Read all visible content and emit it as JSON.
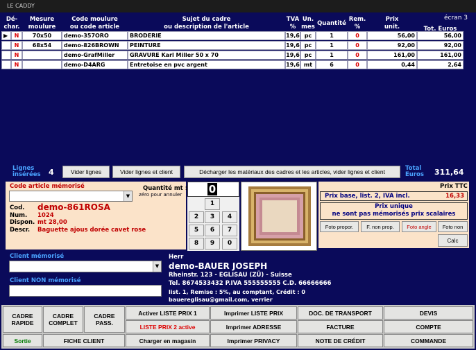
{
  "window": {
    "title": "LE CADDY",
    "screen_label": "écran 3"
  },
  "columns": {
    "dechar": "Dé-\nchar.",
    "mesure": "Mesure\nmoulure",
    "code": "Code moulure\nou code article",
    "sujet": "Sujet du cadre\nou description de l'article",
    "tva": "TVA\n%",
    "unmes": "Un.\nmes",
    "quantite": "Quantité",
    "rem": "Rem.\n%",
    "prix": "Prix\nunit.",
    "total": "Tot. Euros"
  },
  "rows": [
    {
      "pointer": "▶",
      "flag": "N",
      "mesure": "70x50",
      "code": "demo-357ORO",
      "desc": "BRODERIE",
      "tva": "19,6",
      "unit": "pc",
      "qty": "1",
      "rem": "0",
      "prix": "56,00",
      "total": "56,00"
    },
    {
      "pointer": "",
      "flag": "N",
      "mesure": "68x54",
      "code": "demo-826BROWN",
      "desc": "PEINTURE",
      "tva": "19,6",
      "unit": "pc",
      "qty": "1",
      "rem": "0",
      "prix": "92,00",
      "total": "92,00"
    },
    {
      "pointer": "",
      "flag": "N",
      "mesure": "",
      "code": "demo-GrafMiller",
      "desc": "GRAVURE Karl Miller 50 x 70",
      "tva": "19,6",
      "unit": "pc",
      "qty": "1",
      "rem": "0",
      "prix": "161,00",
      "total": "161,00"
    },
    {
      "pointer": "",
      "flag": "N",
      "mesure": "",
      "code": "demo-D4ARG",
      "desc": "Entretoise en pvc argent",
      "tva": "19,6",
      "unit": "mt",
      "qty": "6",
      "rem": "0",
      "prix": "0,44",
      "total": "2,64"
    }
  ],
  "summary": {
    "lignes_label": "Lignes\ninsérées",
    "lignes_count": "4",
    "vider_lignes": "Vider lignes",
    "vider_lignes_client": "Vider lignes et client",
    "decharger": "Décharger les matériaux des cadres et les articles, vider lignes et client",
    "total_label": "Total\nEuros",
    "total_value": "311,64"
  },
  "article": {
    "code_label": "Code article mémorisé",
    "qty_label": "Quantité mt :",
    "qty_value": "0",
    "zero_hint": "zéro pour annuler",
    "cod_label": "Cod.",
    "cod_value": "demo-861ROSA",
    "num_label": "Num.",
    "num_value": "1024",
    "dispon_label": "Dispon.",
    "dispon_value": "mt 28,00",
    "descr_label": "Descr.",
    "descr_value": "Baguette ajous dorée cavet rose"
  },
  "keypad": {
    "k1": "1",
    "k2": "2",
    "k3": "3",
    "k4": "4",
    "k5": "5",
    "k6": "6",
    "k7": "7",
    "k8": "8",
    "k9": "9",
    "k0": "0"
  },
  "pricing": {
    "prix_ttc": "Prix TTC",
    "prix_base": "Prix base, list. 2, IVA incl.",
    "prix_base_value": "16,33",
    "prix_unique": "Prix unique",
    "not_memorized": "ne sont pas mémorisés prix scalaires",
    "foto_propor": "Foto propor.",
    "f_non_prop": "F. non prop.",
    "foto_angle": "Foto angle",
    "foto_non": "Foto non",
    "calc": "Calc"
  },
  "client": {
    "memorise_label": "Client mémorisé",
    "non_memorise_label": "Client NON mémorisé",
    "salutation": "Herr",
    "name": "demo-BAUER JOSEPH",
    "address": "Rheinstr. 123 - EGLISAU  (ZÜ) - Suisse",
    "phone": "Tel. 8674533432  P.IVA 555555555   C.D. 66666666",
    "list": "list. 1,  Remise : 5%, au comptant,  Crédit : 0",
    "email": "bauereglisau@gmail.com, verrier"
  },
  "buttons": {
    "cadre_rapide": "CADRE\nRAPIDE",
    "cadre_complet": "CADRE\nCOMPLET",
    "cadre_pass": "CADRE\nPASS.",
    "activer_liste": "Activer LISTE PRIX 1",
    "liste_prix_2": "LISTE PRIX 2 active",
    "charger": "Charger en magasin",
    "imprimer_liste": "Imprimer LISTE PRIX",
    "imprimer_adresse": "Imprimer ADRESSE",
    "imprimer_privacy": "Imprimer PRIVACY",
    "doc_transport": "DOC. DE TRANSPORT",
    "facture": "FACTURE",
    "note_credit": "NOTE DE CRÉDIT",
    "devis": "DEVIS",
    "compte": "COMPTE",
    "commande": "COMMANDE",
    "sortie": "Sortie",
    "fiche_client": "FICHE CLIENT"
  },
  "colors": {
    "bg_navy": "#0a0a5a",
    "red_text": "#dd0000",
    "green_text": "#007a00",
    "peach": "#fbe3c9"
  }
}
